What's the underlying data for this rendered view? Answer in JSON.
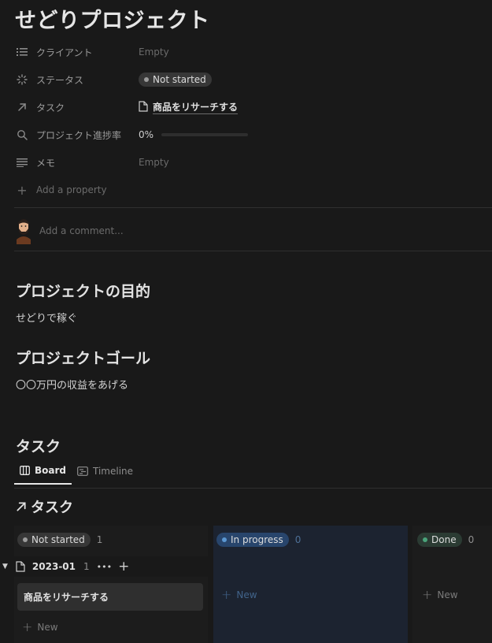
{
  "page": {
    "title": "せどりプロジェクト"
  },
  "properties": {
    "client": {
      "name": "クライアント",
      "value": "Empty"
    },
    "status": {
      "name": "ステータス",
      "value": "Not started"
    },
    "task": {
      "name": "タスク",
      "value": "商品をリサーチする"
    },
    "progress": {
      "name": "プロジェクト進捗率",
      "value": "0%",
      "fraction": 0
    },
    "memo": {
      "name": "メモ",
      "value": "Empty"
    },
    "add_property": "Add a property"
  },
  "comment": {
    "placeholder": "Add a comment..."
  },
  "content": {
    "purpose_heading": "プロジェクトの目的",
    "purpose_text": "せどりで稼ぐ",
    "goal_heading": "プロジェクトゴール",
    "goal_text": "〇〇万円の収益をあげる",
    "tasks_heading": "タスク"
  },
  "views": {
    "tabs": [
      {
        "label": "Board",
        "active": true
      },
      {
        "label": "Timeline",
        "active": false
      }
    ]
  },
  "board": {
    "title": "タスク",
    "columns": [
      {
        "label": "Not started",
        "count": "1",
        "color": "#9b9b9b",
        "pill_bg": "#373737"
      },
      {
        "label": "In progress",
        "count": "0",
        "color": "#5b97d1",
        "pill_bg": "#28456c"
      },
      {
        "label": "Done",
        "count": "0",
        "color": "#4aa37a",
        "pill_bg": "#2b3b33"
      }
    ],
    "group": {
      "label": "2023-01",
      "count": "1",
      "more": "•••",
      "add": "+"
    },
    "card": {
      "title": "商品をリサーチする"
    },
    "new_label": "New"
  },
  "colors": {
    "background": "#191919",
    "card": "#2f2f2f",
    "progress_column_bg": "#1c2330"
  }
}
